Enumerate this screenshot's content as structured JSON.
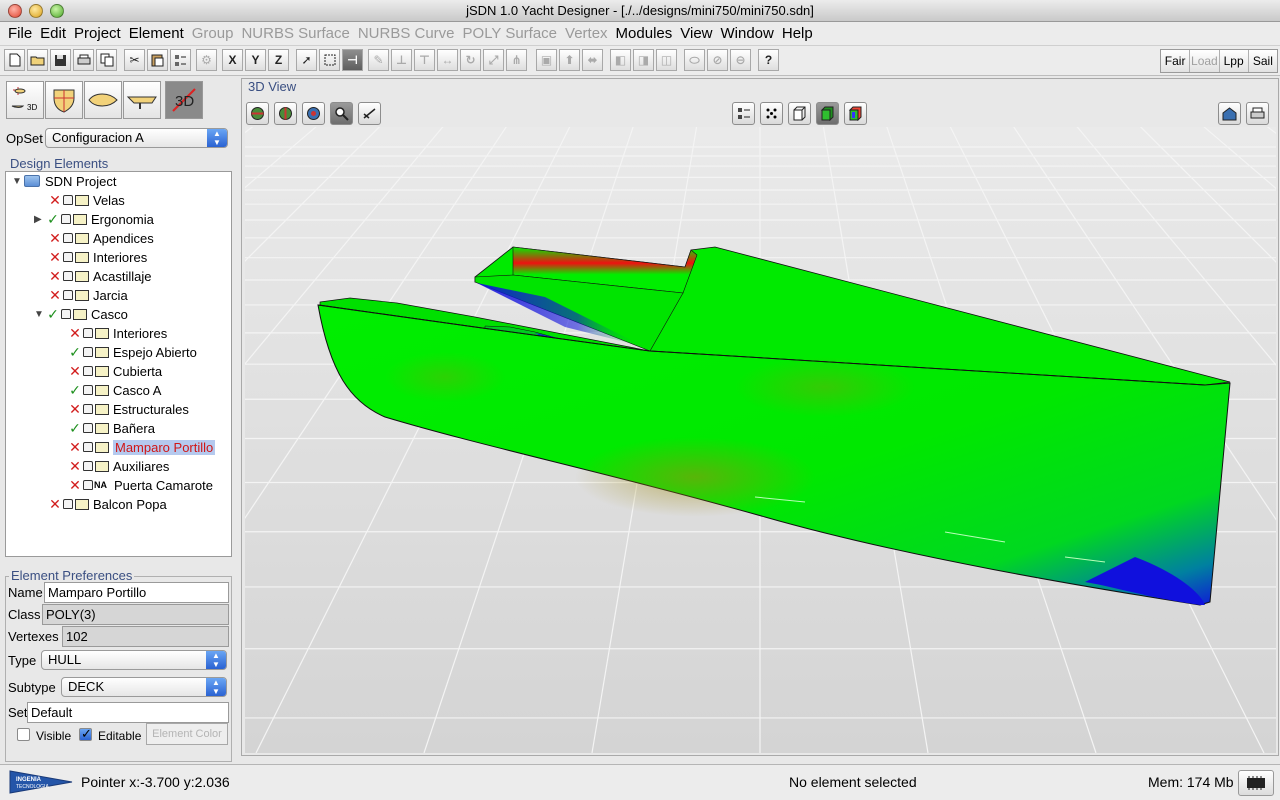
{
  "window": {
    "title": "jSDN 1.0 Yacht Designer - [./../designs/mini750/mini750.sdn]"
  },
  "menu": [
    {
      "label": "File",
      "enabled": true
    },
    {
      "label": "Edit",
      "enabled": true
    },
    {
      "label": "Project",
      "enabled": true
    },
    {
      "label": "Element",
      "enabled": true
    },
    {
      "label": "Group",
      "enabled": false
    },
    {
      "label": "NURBS Surface",
      "enabled": false
    },
    {
      "label": "NURBS Curve",
      "enabled": false
    },
    {
      "label": "POLY Surface",
      "enabled": false
    },
    {
      "label": "Vertex",
      "enabled": false
    },
    {
      "label": "Modules",
      "enabled": true
    },
    {
      "label": "View",
      "enabled": true
    },
    {
      "label": "Window",
      "enabled": true
    },
    {
      "label": "Help",
      "enabled": true
    }
  ],
  "toolbar": {
    "axis": {
      "x": "X",
      "y": "Y",
      "z": "Z"
    },
    "help": "?",
    "modules": [
      {
        "label": "Fair",
        "enabled": true
      },
      {
        "label": "Load",
        "enabled": false
      },
      {
        "label": "Lpp",
        "enabled": true
      },
      {
        "label": "Sail",
        "enabled": true
      }
    ]
  },
  "left": {
    "view3d_label": "3D",
    "opset_label": "OpSet",
    "opset_value": "Configuracion A",
    "tree_title": "Design Elements",
    "tree": {
      "root": "SDN Project",
      "items": [
        {
          "label": "Velas",
          "status": "x"
        },
        {
          "label": "Ergonomia",
          "status": "ok",
          "expandable": true
        },
        {
          "label": "Apendices",
          "status": "x"
        },
        {
          "label": "Interiores",
          "status": "x"
        },
        {
          "label": "Acastillaje",
          "status": "x"
        },
        {
          "label": "Jarcia",
          "status": "x"
        },
        {
          "label": "Casco",
          "status": "ok",
          "expanded": true
        }
      ],
      "casco_children": [
        {
          "label": "Interiores",
          "status": "x"
        },
        {
          "label": "Espejo Abierto",
          "status": "ok"
        },
        {
          "label": "Cubierta",
          "status": "x"
        },
        {
          "label": "Casco A",
          "status": "ok"
        },
        {
          "label": "Estructurales",
          "status": "x"
        },
        {
          "label": "Bañera",
          "status": "ok"
        },
        {
          "label": "Mamparo Portillo",
          "status": "x",
          "selected": true
        },
        {
          "label": "Auxiliares",
          "status": "x"
        },
        {
          "label": "Puerta Camarote",
          "status": "x",
          "icon_text": "NA"
        }
      ],
      "after": [
        {
          "label": "Balcon Popa",
          "status": "x"
        }
      ]
    },
    "prefs": {
      "title": "Element Preferences",
      "name_label": "Name",
      "name_value": "Mamparo Portillo",
      "class_label": "Class",
      "class_value": "POLY(3)",
      "vertexes_label": "Vertexes",
      "vertexes_value": "102",
      "type_label": "Type",
      "type_value": "HULL",
      "subtype_label": "Subtype",
      "subtype_value": "DECK",
      "set_label": "Set",
      "set_value": "Default",
      "visible_label": "Visible",
      "visible_checked": false,
      "editable_label": "Editable",
      "editable_checked": true,
      "color_button": "Element Color"
    }
  },
  "view": {
    "title": "3D View",
    "colors": {
      "hull": "#00ee00",
      "stress_high": "#ee1111",
      "stress_low": "#1010dd",
      "floor": "#d8d8d8",
      "grid": "#f2f2f2"
    }
  },
  "status": {
    "logo_text": "INGENIA TECNOLOGIA",
    "pointer": "Pointer x:-3.700 y:2.036",
    "selection": "No element selected",
    "memory": "Mem: 174 Mb"
  }
}
